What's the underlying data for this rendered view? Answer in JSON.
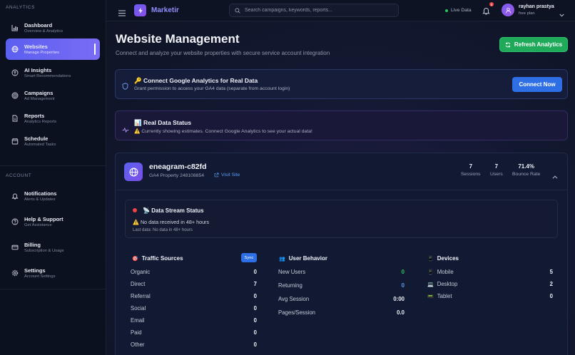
{
  "sidebar": {
    "section_analytics": "ANALYTICS",
    "section_account": "ACCOUNT",
    "items": [
      {
        "label": "Dashboard",
        "sub": "Overview & Analytics"
      },
      {
        "label": "Websites",
        "sub": "Manage Properties"
      },
      {
        "label": "AI Insights",
        "sub": "Smart Recommendations"
      },
      {
        "label": "Campaigns",
        "sub": "Ad Management"
      },
      {
        "label": "Reports",
        "sub": "Analytics Reports"
      },
      {
        "label": "Schedule",
        "sub": "Automated Tasks"
      }
    ],
    "account_items": [
      {
        "label": "Notifications",
        "sub": "Alerts & Updates"
      },
      {
        "label": "Help & Support",
        "sub": "Get Assistance"
      },
      {
        "label": "Billing",
        "sub": "Subscription & Usage"
      },
      {
        "label": "Settings",
        "sub": "Account Settings"
      }
    ]
  },
  "topbar": {
    "app_name": "Marketir",
    "search_placeholder": "Search campaigns, keywords, reports...",
    "live_label": "Live Data",
    "notification_count": "3",
    "user_name": "rayhan prastya",
    "user_plan": "free plan"
  },
  "colors": {
    "accent": "#5b5ff0",
    "success": "#1faa5a",
    "primary_button": "#2f6fe6",
    "danger": "#ef4444"
  },
  "page": {
    "title": "Website Management",
    "subtitle": "Connect and analyze your website properties with secure service account integration",
    "refresh_label": "Refresh Analytics"
  },
  "ga_card": {
    "emoji": "🔑",
    "title": "Connect Google Analytics for Real Data",
    "desc": "Grant permission to access your GA4 data (separate from account login)",
    "button": "Connect Now"
  },
  "real_data": {
    "emoji": "📊",
    "title": "Real Data Status",
    "warn_emoji": "⚠️",
    "desc": "Currently showing estimates. Connect Google Analytics to see your actual data!"
  },
  "property": {
    "name": "eneagram-c82fd",
    "id": "GA4 Property 248108854",
    "visit_label": "Visit Site",
    "stats": [
      {
        "value": "7",
        "label": "Sessions"
      },
      {
        "value": "7",
        "label": "Users"
      },
      {
        "value": "71.4%",
        "label": "Bounce Rate"
      }
    ],
    "stream": {
      "emoji": "📡",
      "title": "Data Stream Status",
      "warn_emoji": "⚠️",
      "message": "No data received in 48+ hours",
      "last_data": "Last data: No data in 48+ hours"
    },
    "traffic": {
      "emoji": "🎯",
      "title": "Traffic Sources",
      "sync_label": "Sync",
      "rows": [
        {
          "label": "Organic",
          "value": "0"
        },
        {
          "label": "Direct",
          "value": "7"
        },
        {
          "label": "Referral",
          "value": "0"
        },
        {
          "label": "Social",
          "value": "0"
        },
        {
          "label": "Email",
          "value": "0"
        },
        {
          "label": "Paid",
          "value": "0"
        },
        {
          "label": "Other",
          "value": "0"
        }
      ]
    },
    "behavior": {
      "emoji": "👥",
      "title": "User Behavior",
      "rows": [
        {
          "label": "New Users",
          "value": "0"
        },
        {
          "label": "Returning",
          "value": "0"
        },
        {
          "label": "Avg Session",
          "value": "0:00"
        },
        {
          "label": "Pages/Session",
          "value": "0.0"
        }
      ]
    },
    "devices": {
      "emoji": "📱",
      "title": "Devices",
      "rows": [
        {
          "emoji": "📱",
          "label": "Mobile",
          "value": "5"
        },
        {
          "emoji": "💻",
          "label": "Desktop",
          "value": "2"
        },
        {
          "emoji": "📟",
          "label": "Tablet",
          "value": "0"
        }
      ]
    }
  }
}
